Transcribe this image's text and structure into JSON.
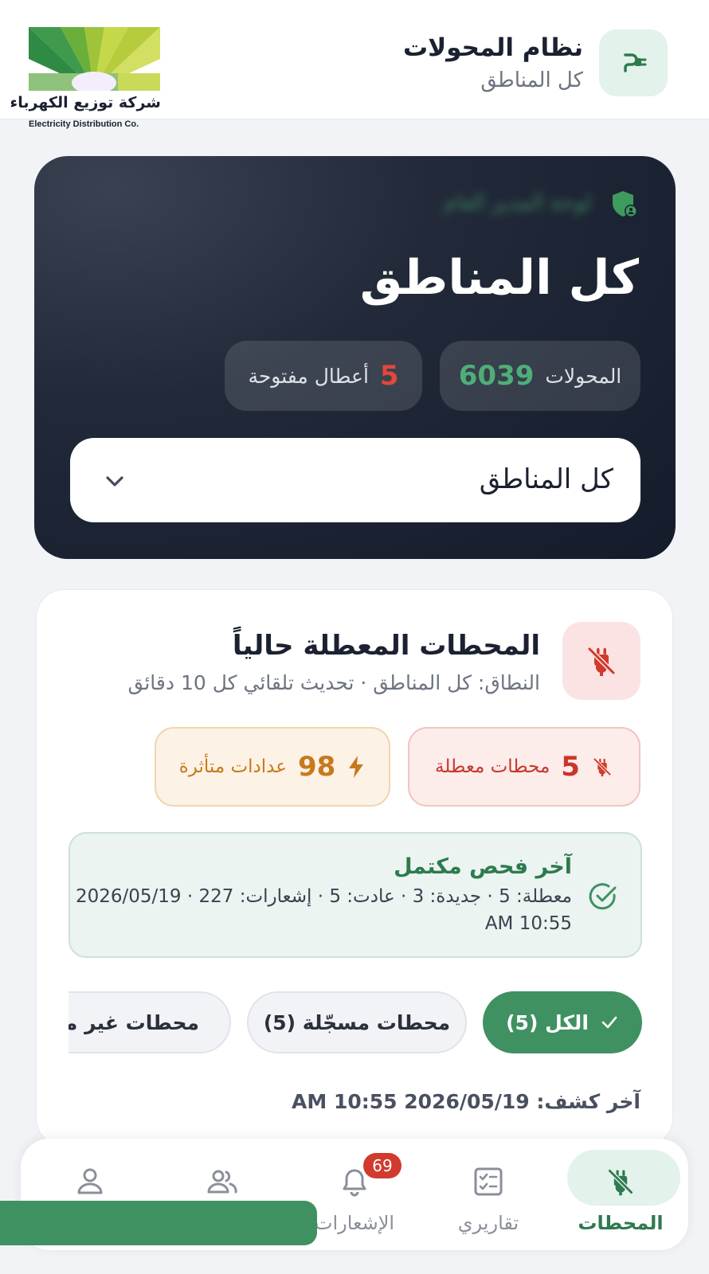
{
  "header": {
    "title": "نظام المحولات",
    "subtitle": "كل المناطق",
    "app_icon": "plug-icon",
    "logo": {
      "name_ar": "شركة توزيع الكهرباء",
      "name_en": "Electricity Distribution Co."
    }
  },
  "hero": {
    "role_label": "لوحة المدير العام",
    "title": "كل المناطق",
    "transformers": {
      "count": "6039",
      "label": "المحولات"
    },
    "open_faults": {
      "count": "5",
      "label": "أعطال مفتوحة"
    },
    "region_select": {
      "value": "كل المناطق"
    }
  },
  "outages": {
    "title": "المحطات المعطلة حالياً",
    "subtitle": "النطاق: كل المناطق · تحديث تلقائي كل 10 دقائق",
    "down_stations": {
      "count": "5",
      "label": "محطات معطلة"
    },
    "affected_meters": {
      "count": "98",
      "label": "عدادات متأثرة"
    },
    "last_scan": {
      "title": "آخر فحص مكتمل",
      "line1": "معطلة: 5 · جديدة: 3 · عادت: 5 · إشعارات: 227 · 2026/05/19",
      "line2": "AM 10:55"
    },
    "filters": [
      {
        "label": "الكل (5)",
        "selected": true
      },
      {
        "label": "محطات مسجّلة (5)",
        "selected": false
      },
      {
        "label": "محطات غير مسجلة",
        "selected": false
      }
    ],
    "last_detection": "آخر كشف: 2026/05/19 10:55 AM"
  },
  "nav": {
    "stations": "المحطات",
    "reports": "تقاريري",
    "notifications": "الإشعارات",
    "notifications_badge": "69",
    "team": "",
    "profile": ""
  },
  "colors": {
    "accent_green": "#3f9162",
    "danger_red": "#d13a2c",
    "warning_orange": "#c8791c",
    "hero_dark": "#182032"
  }
}
